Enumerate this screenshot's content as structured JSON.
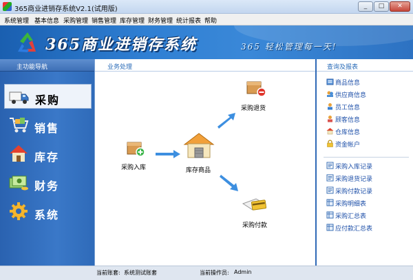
{
  "window": {
    "title": "365商业进销存系统V2.1(试用版)"
  },
  "menu": [
    "系统管理",
    "基本信息",
    "采购管理",
    "销售管理",
    "库存管理",
    "财务管理",
    "统计报表",
    "帮助"
  ],
  "banner": {
    "brand": "365商业进销存系统",
    "slogan": "365 轻松管理每一天!"
  },
  "left_nav": {
    "header": "主功能导航",
    "items": [
      {
        "label": "采购",
        "icon": "truck-icon",
        "active": true
      },
      {
        "label": "销售",
        "icon": "cart-icon",
        "active": false
      },
      {
        "label": "库存",
        "icon": "house-icon",
        "active": false
      },
      {
        "label": "财务",
        "icon": "money-icon",
        "active": false
      },
      {
        "label": "系统",
        "icon": "gear-icon",
        "active": false
      }
    ]
  },
  "center": {
    "header": "业务处理",
    "nodes": {
      "purchase_in": "采购入库",
      "inventory": "库存商品",
      "purchase_return": "采购退货",
      "purchase_payment": "采购付款"
    }
  },
  "right_panel": {
    "header": "查询及报表",
    "info_links": [
      "商品信息",
      "供应商信息",
      "员工信息",
      "顾客信息",
      "仓库信息",
      "资金帐户"
    ],
    "report_links": [
      "采购入库记录",
      "采购退货记录",
      "采购付款记录",
      "采购明细表",
      "采购汇总表",
      "应付款汇总表"
    ]
  },
  "status": {
    "account_label": "当前账套:",
    "account_value": "系统测试账套",
    "operator_label": "当前操作员:",
    "operator_value": "Admin"
  },
  "colors": {
    "banner": "#2f7fd3",
    "nav": "#2d68b8",
    "link": "#1d4fa8",
    "header_text": "#2b6cb8"
  }
}
